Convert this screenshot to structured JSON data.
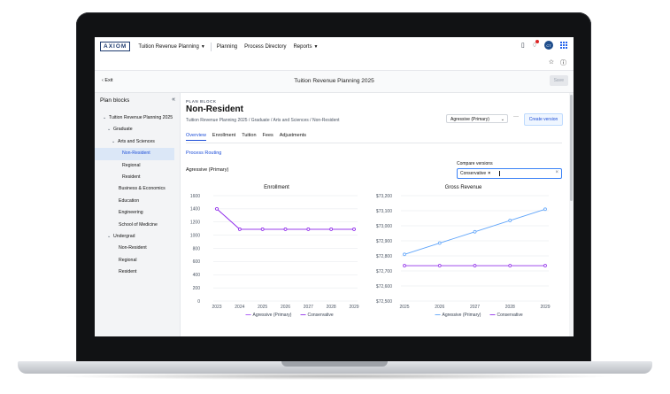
{
  "topnav": {
    "logo": "AXIOM",
    "app_name": "Tuition Revenue Planning",
    "links": [
      "Planning",
      "Process Directory",
      "Reports"
    ],
    "avatar_initials": "CT"
  },
  "titlebar": {
    "exit_label": "Exit",
    "title": "Tuition Revenue Planning 2025",
    "save_label": "Save"
  },
  "sidebar": {
    "heading": "Plan blocks",
    "tree": [
      {
        "label": "Tuition Revenue Planning 2025",
        "level": 0,
        "expanded": true
      },
      {
        "label": "Graduate",
        "level": 1,
        "expanded": true
      },
      {
        "label": "Arts and Sciences",
        "level": 2,
        "expanded": true
      },
      {
        "label": "Non-Resident",
        "level": 3,
        "selected": true
      },
      {
        "label": "Regional",
        "level": 3
      },
      {
        "label": "Resident",
        "level": 3
      },
      {
        "label": "Business & Economics",
        "level": 2
      },
      {
        "label": "Education",
        "level": 2
      },
      {
        "label": "Engineering",
        "level": 2
      },
      {
        "label": "School of Medicine",
        "level": 2
      },
      {
        "label": "Undergrad",
        "level": 1,
        "expanded": true
      },
      {
        "label": "Non-Resident",
        "level": 2
      },
      {
        "label": "Regional",
        "level": 2
      },
      {
        "label": "Resident",
        "level": 2
      }
    ]
  },
  "main": {
    "block_label": "PLAN BLOCK",
    "title": "Non-Resident",
    "breadcrumb": "Tuition Revenue Planning 2025 / Graduate / Arts and Sciences / Non-Resident",
    "version_select": "Agressive (Primary)",
    "create_version_label": "Create version",
    "tabs": [
      "Overview",
      "Enrollment",
      "Tuition",
      "Fees",
      "Adjustments"
    ],
    "active_tab": "Overview",
    "routing_link": "Process Routing",
    "scenario_label": "Agressive (Primary)",
    "compare_label": "Compare versions",
    "compare_chip": "Conservative"
  },
  "colors": {
    "accent": "#1d4ed8",
    "series_primary": "#a855f7",
    "series_revenue": "#60a5fa",
    "series_conservative": "#9333ea"
  },
  "chart_data": [
    {
      "type": "line",
      "title": "Enrollment",
      "x": [
        "2023",
        "2024",
        "2025",
        "2026",
        "2027",
        "2028",
        "2029"
      ],
      "ylim": [
        0,
        1600
      ],
      "yticks": [
        0,
        200,
        400,
        600,
        800,
        1000,
        1200,
        1400,
        1600
      ],
      "ytick_labels": [
        "0",
        "200",
        "400",
        "600",
        "800",
        "1000",
        "1200",
        "1400",
        "1600"
      ],
      "series": [
        {
          "name": "Agressive (Primary)",
          "values": [
            1400,
            1090,
            1090,
            1090,
            1090,
            1090,
            1090
          ]
        },
        {
          "name": "Conservative",
          "values": [
            1400,
            1090,
            1090,
            1090,
            1090,
            1090,
            1090
          ]
        }
      ],
      "legend": "bottom",
      "grid": true
    },
    {
      "type": "line",
      "title": "Gross Revenue",
      "x": [
        "2025",
        "2026",
        "2027",
        "2028",
        "2029"
      ],
      "ylim": [
        72500,
        73200
      ],
      "yticks": [
        72500,
        72600,
        72700,
        72800,
        72900,
        73000,
        73100,
        73200
      ],
      "ytick_labels": [
        "$72,500",
        "$72,600",
        "$72,700",
        "$72,800",
        "$72,900",
        "$73,000",
        "$73,100",
        "$73,200"
      ],
      "series": [
        {
          "name": "Agressive (Primary)",
          "values": [
            72810,
            72885,
            72960,
            73035,
            73110
          ]
        },
        {
          "name": "Conservative",
          "values": [
            72735,
            72735,
            72735,
            72735,
            72735
          ]
        }
      ],
      "legend": "bottom",
      "grid": true
    }
  ]
}
